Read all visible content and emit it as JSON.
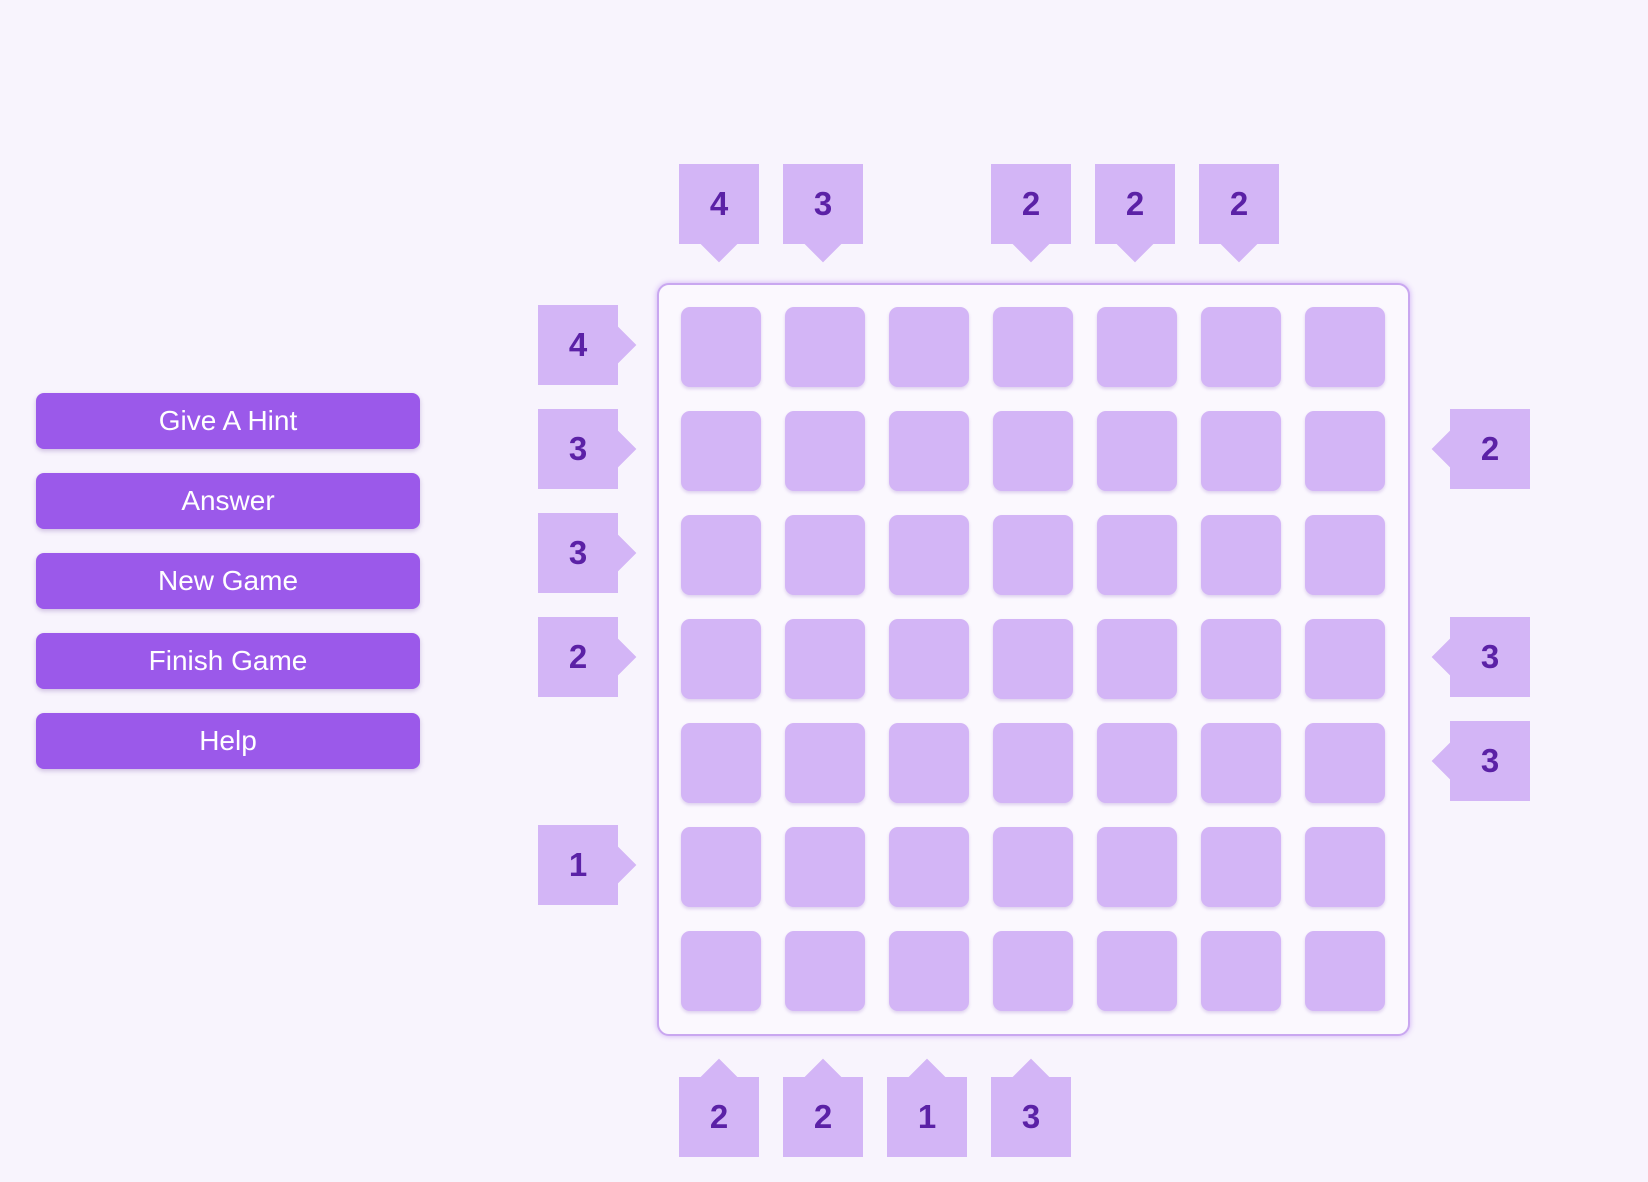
{
  "menu": {
    "hint": "Give A Hint",
    "answer": "Answer",
    "new_game": "New Game",
    "finish": "Finish Game",
    "help": "Help"
  },
  "grid": {
    "rows": 7,
    "cols": 7
  },
  "clues": {
    "top": [
      "4",
      "3",
      "",
      "2",
      "2",
      "2",
      ""
    ],
    "bottom": [
      "2",
      "2",
      "1",
      "3",
      "",
      "",
      ""
    ],
    "left": [
      "4",
      "3",
      "3",
      "2",
      "",
      "1",
      ""
    ],
    "right": [
      "",
      "2",
      "",
      "3",
      "3",
      "",
      ""
    ]
  },
  "colors": {
    "background": "#f8f4fd",
    "button": "#9b59ea",
    "cell": "#d3b5f6",
    "clue_text": "#5b21a6",
    "board_border": "#c9a7f0"
  }
}
